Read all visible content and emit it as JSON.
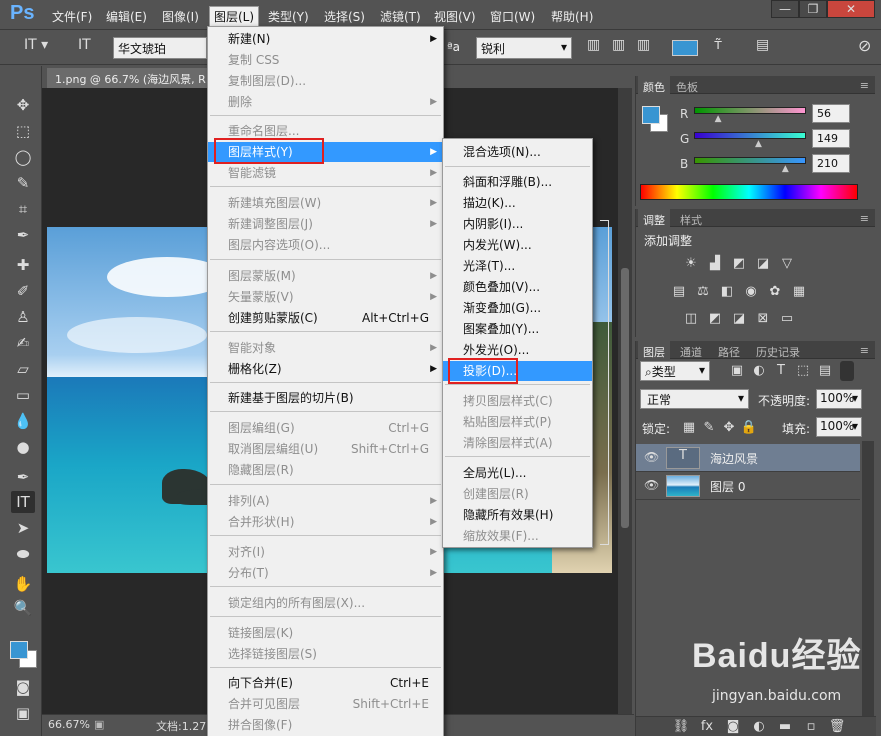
{
  "menubar": {
    "logo": "Ps",
    "items": [
      "文件(F)",
      "编辑(E)",
      "图像(I)",
      "图层(L)",
      "类型(Y)",
      "选择(S)",
      "滤镜(T)",
      "视图(V)",
      "窗口(W)",
      "帮助(H)"
    ],
    "window_buttons": [
      "—",
      "❐",
      "✕"
    ]
  },
  "options": {
    "font": "华文琥珀",
    "aa_label": "ªa",
    "antialias": "锐利"
  },
  "document": {
    "tab": "1.png @ 66.7% (海边风景, R",
    "zoom": "66.67%",
    "doc_info": "文档:1.27"
  },
  "layer_menu": {
    "items": [
      {
        "label": "新建(N)",
        "shortcut": "",
        "submenu": true,
        "disabled": false
      },
      {
        "label": "复制 CSS",
        "shortcut": "",
        "submenu": false,
        "disabled": true
      },
      {
        "label": "复制图层(D)...",
        "shortcut": "",
        "submenu": false,
        "disabled": true
      },
      {
        "label": "删除",
        "shortcut": "",
        "submenu": true,
        "disabled": true
      },
      {
        "label": "重命名图层...",
        "shortcut": "",
        "submenu": false,
        "disabled": true
      },
      {
        "label": "图层样式(Y)",
        "shortcut": "",
        "submenu": true,
        "disabled": false,
        "highlight": true
      },
      {
        "label": "智能滤镜",
        "shortcut": "",
        "submenu": true,
        "disabled": true
      },
      {
        "label": "新建填充图层(W)",
        "shortcut": "",
        "submenu": true,
        "disabled": true
      },
      {
        "label": "新建调整图层(J)",
        "shortcut": "",
        "submenu": true,
        "disabled": true
      },
      {
        "label": "图层内容选项(O)...",
        "shortcut": "",
        "submenu": false,
        "disabled": true
      },
      {
        "label": "图层蒙版(M)",
        "shortcut": "",
        "submenu": true,
        "disabled": true
      },
      {
        "label": "矢量蒙版(V)",
        "shortcut": "",
        "submenu": true,
        "disabled": true
      },
      {
        "label": "创建剪贴蒙版(C)",
        "shortcut": "Alt+Ctrl+G",
        "submenu": false,
        "disabled": false
      },
      {
        "label": "智能对象",
        "shortcut": "",
        "submenu": true,
        "disabled": true
      },
      {
        "label": "栅格化(Z)",
        "shortcut": "",
        "submenu": true,
        "disabled": false
      },
      {
        "label": "新建基于图层的切片(B)",
        "shortcut": "",
        "submenu": false,
        "disabled": false
      },
      {
        "label": "图层编组(G)",
        "shortcut": "Ctrl+G",
        "submenu": false,
        "disabled": true
      },
      {
        "label": "取消图层编组(U)",
        "shortcut": "Shift+Ctrl+G",
        "submenu": false,
        "disabled": true
      },
      {
        "label": "隐藏图层(R)",
        "shortcut": "",
        "submenu": false,
        "disabled": true
      },
      {
        "label": "排列(A)",
        "shortcut": "",
        "submenu": true,
        "disabled": true
      },
      {
        "label": "合并形状(H)",
        "shortcut": "",
        "submenu": true,
        "disabled": true
      },
      {
        "label": "对齐(I)",
        "shortcut": "",
        "submenu": true,
        "disabled": true
      },
      {
        "label": "分布(T)",
        "shortcut": "",
        "submenu": true,
        "disabled": true
      },
      {
        "label": "锁定组内的所有图层(X)...",
        "shortcut": "",
        "submenu": false,
        "disabled": true
      },
      {
        "label": "链接图层(K)",
        "shortcut": "",
        "submenu": false,
        "disabled": true
      },
      {
        "label": "选择链接图层(S)",
        "shortcut": "",
        "submenu": false,
        "disabled": true
      },
      {
        "label": "向下合并(E)",
        "shortcut": "Ctrl+E",
        "submenu": false,
        "disabled": false
      },
      {
        "label": "合并可见图层",
        "shortcut": "Shift+Ctrl+E",
        "submenu": false,
        "disabled": true
      },
      {
        "label": "拼合图像(F)",
        "shortcut": "",
        "submenu": false,
        "disabled": true
      }
    ]
  },
  "style_submenu": {
    "items": [
      {
        "label": "混合选项(N)...",
        "disabled": false
      },
      {
        "label": "斜面和浮雕(B)...",
        "disabled": false
      },
      {
        "label": "描边(K)...",
        "disabled": false
      },
      {
        "label": "内阴影(I)...",
        "disabled": false
      },
      {
        "label": "内发光(W)...",
        "disabled": false
      },
      {
        "label": "光泽(T)...",
        "disabled": false
      },
      {
        "label": "颜色叠加(V)...",
        "disabled": false
      },
      {
        "label": "渐变叠加(G)...",
        "disabled": false
      },
      {
        "label": "图案叠加(Y)...",
        "disabled": false
      },
      {
        "label": "外发光(O)...",
        "disabled": false
      },
      {
        "label": "投影(D)...",
        "disabled": false,
        "highlight": true
      },
      {
        "label": "拷贝图层样式(C)",
        "disabled": true
      },
      {
        "label": "粘贴图层样式(P)",
        "disabled": true
      },
      {
        "label": "清除图层样式(A)",
        "disabled": true
      },
      {
        "label": "全局光(L)...",
        "disabled": false
      },
      {
        "label": "创建图层(R)",
        "disabled": true
      },
      {
        "label": "隐藏所有效果(H)",
        "disabled": false
      },
      {
        "label": "缩放效果(F)...",
        "disabled": true
      }
    ]
  },
  "color_panel": {
    "tabs": [
      "颜色",
      "色板"
    ],
    "r_label": "R",
    "g_label": "G",
    "b_label": "B",
    "r": "56",
    "g": "149",
    "b": "210",
    "r_level": 0.22,
    "g_level": 0.58,
    "b_level": 0.82,
    "foreground": "#3895d2",
    "background": "#ffffff"
  },
  "adjust_panel": {
    "tabs": [
      "调整",
      "样式"
    ],
    "title": "添加调整"
  },
  "layers_panel": {
    "tabs": [
      "图层",
      "通道",
      "路径",
      "历史记录"
    ],
    "filter": "类型",
    "blend_mode": "正常",
    "opacity_label": "不透明度:",
    "opacity": "100%",
    "lock_label": "锁定:",
    "fill_label": "填充:",
    "fill": "100%",
    "layers": [
      "海边风景",
      "图层 0"
    ]
  },
  "watermark": {
    "brand": "Baidu经验",
    "url": "jingyan.baidu.com"
  }
}
